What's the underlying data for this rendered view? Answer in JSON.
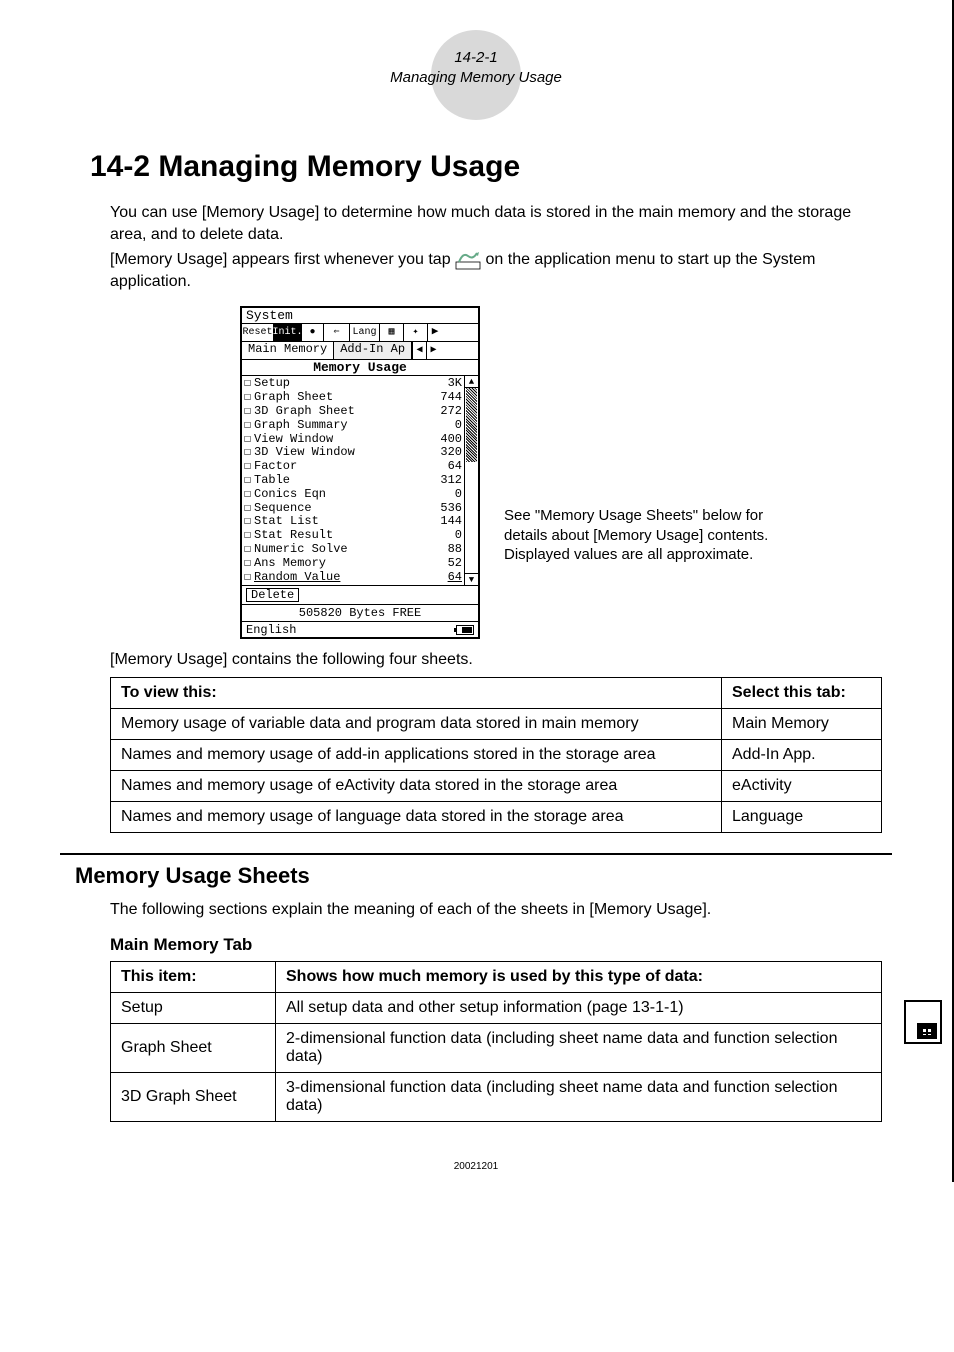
{
  "header": {
    "badge_num": "14-2-1",
    "badge_title": "Managing Memory Usage"
  },
  "section_title": "14-2  Managing Memory Usage",
  "intro": {
    "p1": "You can use [Memory Usage] to determine how much data is stored in the main memory and the storage area, and to delete data.",
    "p2a": "[Memory Usage] appears first whenever you tap ",
    "p2b": " on the application menu to start up the System application.",
    "icon_label": "System"
  },
  "calc": {
    "title": "System",
    "toolbar": [
      "Reset",
      "Init.",
      "●",
      "⇐",
      "Lang",
      "▦",
      "✦"
    ],
    "tabs": {
      "active": "Main Memory",
      "next": "Add-In Ap"
    },
    "subheader": "Memory  Usage",
    "items": [
      {
        "name": "Setup",
        "val": "3K"
      },
      {
        "name": "Graph Sheet",
        "val": "744"
      },
      {
        "name": "3D Graph Sheet",
        "val": "272"
      },
      {
        "name": "Graph Summary",
        "val": "0"
      },
      {
        "name": "View Window",
        "val": "400"
      },
      {
        "name": "3D View Window",
        "val": "320"
      },
      {
        "name": "Factor",
        "val": "64"
      },
      {
        "name": "Table",
        "val": "312"
      },
      {
        "name": "Conics Eqn",
        "val": "0"
      },
      {
        "name": "Sequence",
        "val": "536"
      },
      {
        "name": "Stat List",
        "val": "144"
      },
      {
        "name": "Stat Result",
        "val": "0"
      },
      {
        "name": "Numeric Solve",
        "val": "88"
      },
      {
        "name": "Ans Memory",
        "val": "52"
      },
      {
        "name": "Random Value",
        "val": "64"
      }
    ],
    "delete_btn": "Delete",
    "free_line": "505820 Bytes FREE",
    "status_lang": "English"
  },
  "side_note": {
    "l1": "See \"Memory Usage Sheets\" below for details about [Memory Usage] contents.",
    "l2": "Displayed values are all approximate."
  },
  "sheets_intro": "[Memory Usage] contains the following four sheets.",
  "sheets_table": {
    "h1": "To view this:",
    "h2": "Select this tab:",
    "rows": [
      {
        "a": "Memory usage of variable data and program data stored in main memory",
        "b": "Main Memory"
      },
      {
        "a": "Names and memory usage of add-in applications stored in the storage area",
        "b": "Add-In App."
      },
      {
        "a": "Names and memory usage of eActivity data stored in the storage area",
        "b": "eActivity"
      },
      {
        "a": "Names and memory usage of language data stored in the storage area",
        "b": "Language"
      }
    ]
  },
  "subsec_heading": "Memory Usage Sheets",
  "subsec_intro": "The following sections explain the meaning of each of the sheets in [Memory Usage].",
  "mainmem_heading": "Main Memory Tab",
  "mainmem_table": {
    "h1": "This item:",
    "h2": "Shows how much memory is used by this type of data:",
    "rows": [
      {
        "a": "Setup",
        "b": "All setup data and other setup information (page 13-1-1)"
      },
      {
        "a": "Graph Sheet",
        "b": "2-dimensional function data (including sheet name data and function selection data)"
      },
      {
        "a": "3D Graph Sheet",
        "b": "3-dimensional function data (including sheet name data and function selection data)"
      }
    ]
  },
  "footer_code": "20021201"
}
